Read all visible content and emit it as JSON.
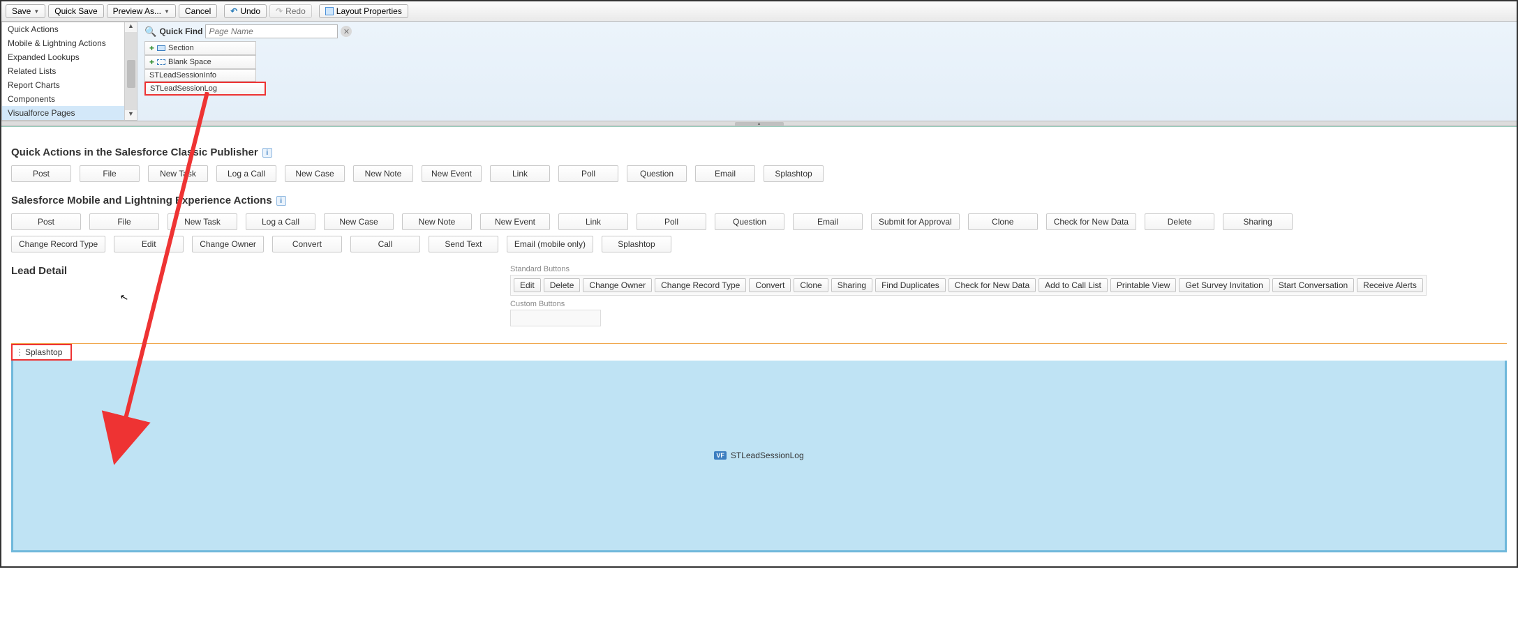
{
  "toolbar": {
    "save": "Save",
    "quick_save": "Quick Save",
    "preview_as": "Preview As...",
    "cancel": "Cancel",
    "undo": "Undo",
    "redo": "Redo",
    "layout_props": "Layout Properties"
  },
  "categories": [
    "Quick Actions",
    "Mobile & Lightning Actions",
    "Expanded Lookups",
    "Related Lists",
    "Report Charts",
    "Components",
    "Visualforce Pages"
  ],
  "selected_category_index": 6,
  "quick_find": {
    "label": "Quick Find",
    "placeholder": "Page Name"
  },
  "elements": [
    {
      "label": "Section",
      "icon": "section"
    },
    {
      "label": "Blank Space",
      "icon": "blank"
    },
    {
      "label": "STLeadSessionInfo",
      "icon": "none"
    },
    {
      "label": "STLeadSessionLog",
      "icon": "none",
      "highlight": true
    }
  ],
  "sections": {
    "classic_title": "Quick Actions in the Salesforce Classic Publisher",
    "classic_actions": [
      "Post",
      "File",
      "New Task",
      "Log a Call",
      "New Case",
      "New Note",
      "New Event",
      "Link",
      "Poll",
      "Question",
      "Email",
      "Splashtop"
    ],
    "lex_title": "Salesforce Mobile and Lightning Experience Actions",
    "lex_actions_row1": [
      "Post",
      "File",
      "New Task",
      "Log a Call",
      "New Case",
      "New Note",
      "New Event",
      "Link",
      "Poll",
      "Question",
      "Email",
      "Submit for Approval",
      "Clone",
      "Check for New Data",
      "Delete",
      "Sharing"
    ],
    "lex_actions_row2": [
      "Change Record Type",
      "Edit",
      "Change Owner",
      "Convert",
      "Call",
      "Send Text",
      "Email (mobile only)",
      "Splashtop"
    ]
  },
  "lead_detail": {
    "title": "Lead Detail",
    "std_label": "Standard Buttons",
    "std_buttons": [
      "Edit",
      "Delete",
      "Change Owner",
      "Change Record Type",
      "Convert",
      "Clone",
      "Sharing",
      "Find Duplicates",
      "Check for New Data",
      "Add to Call List",
      "Printable View",
      "Get Survey Invitation",
      "Start Conversation",
      "Receive Alerts"
    ],
    "custom_label": "Custom Buttons"
  },
  "vf_section": {
    "tab_label": "Splashtop",
    "page_badge": "VF",
    "page_name": "STLeadSessionLog"
  }
}
